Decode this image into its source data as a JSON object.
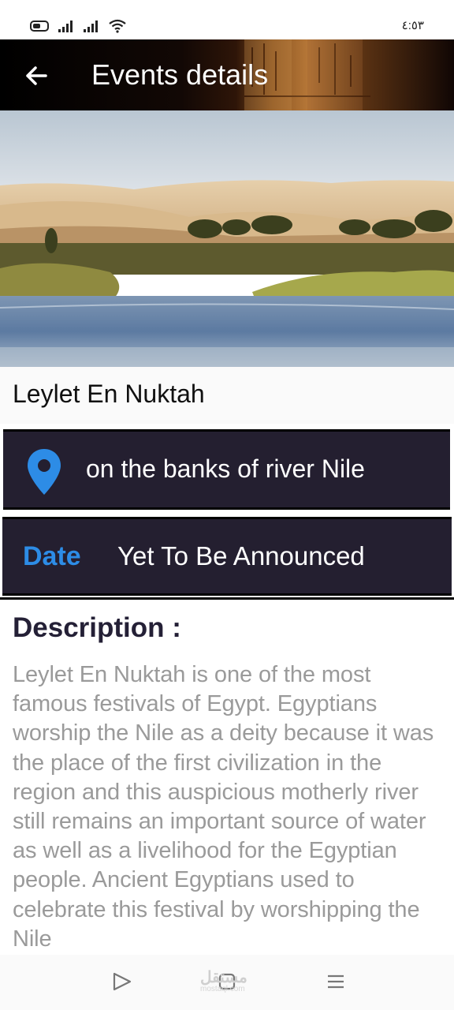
{
  "status_bar": {
    "time": "٤:٥٣",
    "icons": [
      "battery-icon",
      "signal-icon",
      "signal-icon",
      "wifi-icon"
    ]
  },
  "app_bar": {
    "title": "Events details",
    "back_icon": "arrow-left-icon"
  },
  "hero": {
    "description_alt": "Nile river with desert dunes and palm trees"
  },
  "event": {
    "title": "Leylet En Nuktah",
    "location_icon": "map-pin-icon",
    "location": "on the banks of river Nile",
    "date_label": "Date",
    "date_value": "Yet To Be Announced",
    "description_heading": "Description :",
    "description": "Leylet En Nuktah is one of the most famous festivals of Egypt. Egyptians worship the Nile as a deity because it was the place of the first civilization in the region and this auspicious motherly river still remains an important source of water as well as a livelihood for the Egyptian people. Ancient Egyptians used to celebrate this festival by worshipping the Nile"
  },
  "nav_bar": {
    "icons": [
      "back-triangle-icon",
      "home-square-icon",
      "menu-lines-icon"
    ],
    "watermark": "مستقل",
    "watermark_sub": "mostaql.com"
  },
  "colors": {
    "card_bg": "#241f30",
    "accent_blue": "#2d8ce6",
    "description_text": "#9a9a9a",
    "heading_dark": "#242036"
  }
}
